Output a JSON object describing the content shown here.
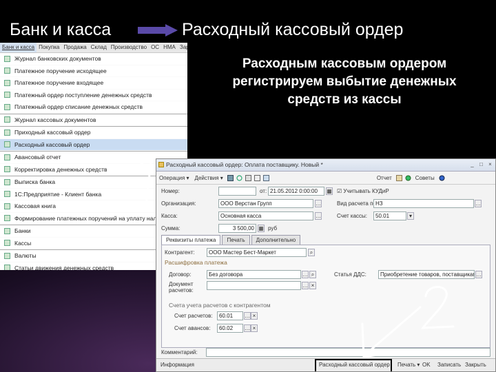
{
  "header": {
    "left": "Банк и касса",
    "right": "Расходный кассовый ордер"
  },
  "caption": {
    "line1": "Расходным кассовым ордером",
    "line2": "регистрируем выбытие денежных",
    "line3": "средств из кассы"
  },
  "menu": {
    "bar": [
      "Банк и касса",
      "Покупка",
      "Продажа",
      "Склад",
      "Производство",
      "ОС",
      "НМА",
      "Зарпл"
    ],
    "items": [
      {
        "label": "Журнал банковских документов",
        "sep": false,
        "sel": false
      },
      {
        "label": "Платежное поручение исходящее",
        "sep": false,
        "sel": false
      },
      {
        "label": "Платежное поручение входящее",
        "sep": false,
        "sel": false
      },
      {
        "label": "Платежный ордер поступление денежных средств",
        "sep": false,
        "sel": false
      },
      {
        "label": "Платежный ордер списание денежных средств",
        "sep": false,
        "sel": false
      },
      {
        "label": "Журнал кассовых документов",
        "sep": true,
        "sel": false
      },
      {
        "label": "Приходный кассовый ордер",
        "sep": true,
        "sel": false
      },
      {
        "label": "Расходный кассовый ордер",
        "sep": false,
        "sel": true
      },
      {
        "label": "Авансовый отчет",
        "sep": true,
        "sel": false
      },
      {
        "label": "Корректировка денежных средств",
        "sep": false,
        "sel": false
      },
      {
        "label": "Выписка банка",
        "sep": true,
        "sel": false
      },
      {
        "label": "1С:Предприятие - Клиент банка",
        "sep": false,
        "sel": false
      },
      {
        "label": "Кассовая книга",
        "sep": false,
        "sel": false
      },
      {
        "label": "Формирование платежных поручений на уплату налог",
        "sep": false,
        "sel": false
      },
      {
        "label": "Банки",
        "sep": true,
        "sel": false
      },
      {
        "label": "Кассы",
        "sep": false,
        "sel": false
      },
      {
        "label": "Валюты",
        "sep": true,
        "sel": false
      },
      {
        "label": "Статьи движения денежных средств",
        "sep": false,
        "sel": false
      }
    ]
  },
  "doc": {
    "title": "Расходный кассовый ордер: Оплата поставщику. Новый *",
    "toolbar": {
      "actions": "Операция ▾",
      "actions2": "Действия ▾",
      "select": "Подбор",
      "reports": "Отчет",
      "settings": "Советы"
    },
    "labels": {
      "number": "Номер:",
      "date_from": "от:",
      "org": "Организация:",
      "cashbox": "Касса:",
      "amount": "Сумма:",
      "account_in": "Вид расчета по Н/С:",
      "cash_account": "Счет кассы:",
      "kosgu": "КУДиР",
      "chk": "Учитывать КУДиР"
    },
    "values": {
      "number": "",
      "date": "21.05.2012 0:00:00",
      "org": "ООО Верстан Групп",
      "cashbox": "Основная касса",
      "amount": "3 500,00",
      "currency": "руб",
      "account_in": "НЗ",
      "cash_account": "50.01"
    },
    "tabs": [
      "Реквизиты платежа",
      "Печать",
      "Дополнительно"
    ],
    "payment": {
      "counterparty_label": "Контрагент:",
      "counterparty": "ООО Мастер Бест-Маркет",
      "group1": "Расшифровка платежа",
      "contract_label": "Договор:",
      "contract": "Без договора",
      "doc_label": "Документ расчетов:",
      "dds_label": "Статья ДДС:",
      "dds": "Приобретение товаров, поставщикам",
      "group2": "Счета учета расчетов с контрагентом",
      "settle_label": "Счет расчетов:",
      "settle": "60.01",
      "adv_label": "Счет авансов:",
      "adv": "60.02"
    },
    "comment_label": "Комментарий:",
    "status": {
      "left": "Расходный кассовый ордер",
      "print": "Печать ▾",
      "ok": "OK",
      "save": "Записать",
      "close": "Закрыть",
      "hint": "Информация"
    }
  },
  "annotations": {
    "num1": "1",
    "num2": "2"
  }
}
